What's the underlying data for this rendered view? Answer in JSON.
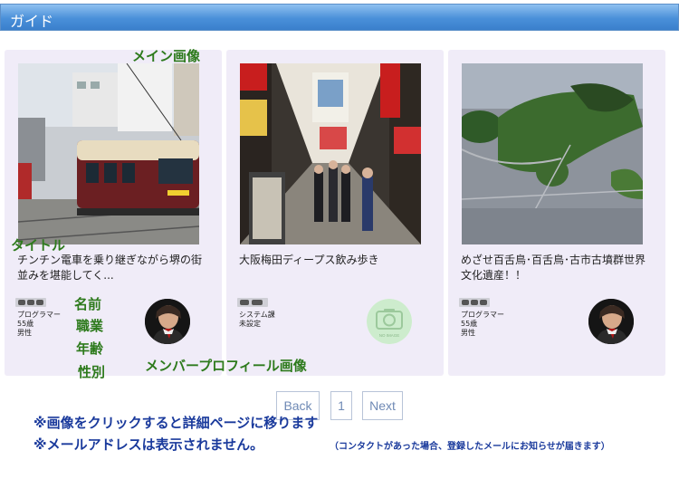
{
  "header": {
    "title": "ガイド"
  },
  "cards": [
    {
      "caption": "チンチン電車を乗り継ぎながら堺の街並みを堪能してく...",
      "job": "プログラマー",
      "age": "55歳",
      "sex": "男性",
      "photo_subject": "tram",
      "avatar": "portrait-avatar"
    },
    {
      "caption": "大阪梅田ディープス飲み歩き",
      "job": "システム課",
      "age": "未設定",
      "sex": "",
      "photo_subject": "shopping-arcade",
      "avatar": "no-image-camera"
    },
    {
      "caption": "めざせ百舌鳥･百舌鳥･古市古墳群世界文化遺産！！",
      "job": "プログラマー",
      "age": "55歳",
      "sex": "男性",
      "photo_subject": "kofun-aerial",
      "avatar": "portrait-avatar"
    }
  ],
  "avatar_placeholder": {
    "text": "NO IMAGE"
  },
  "annotations": {
    "main_image": "メイン画像",
    "title": "タイトル",
    "name": "名前",
    "job": "職業",
    "age": "年齢",
    "sex": "性別",
    "member_profile_image": "メンバープロフィール画像"
  },
  "pagination": {
    "back": "Back",
    "page": "1",
    "next": "Next"
  },
  "notes": {
    "click_image": "※画像をクリックすると詳細ページに移ります",
    "email_hidden": "※メールアドレスは表示されません。",
    "email_notice": "（コンタクトがあった場合、登録したメールにお知らせが届きます）"
  },
  "colors": {
    "header_gradient_top": "#8fc0f0",
    "header_gradient_bottom": "#3a7fcc",
    "card_background": "#f0ecf8",
    "annotation_green": "#2d7a1c",
    "note_blue": "#1a3a9c"
  }
}
